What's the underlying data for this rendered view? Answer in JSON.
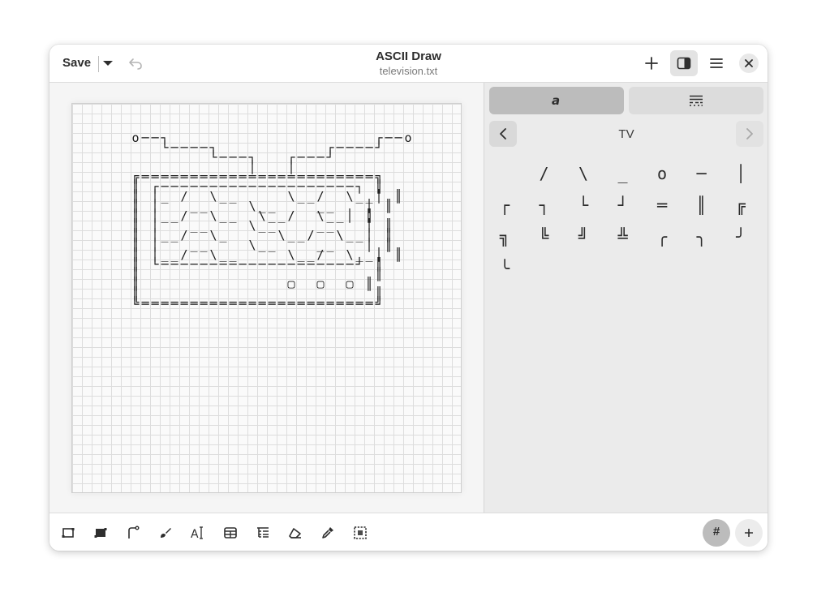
{
  "header": {
    "save_label": "Save",
    "title": "ASCII Draw",
    "subtitle": "television.txt",
    "icons": [
      "chevron-down-icon",
      "undo-icon",
      "plus-icon",
      "sidebar-toggle-icon",
      "hamburger-menu-icon",
      "close-icon"
    ]
  },
  "canvas": {
    "lines": [
      "",
      "",
      "",
      "      o──┐                     ┌──o",
      "         └────┐           ┌────┘",
      "              └───┐   ┌───┘",
      "                  │   │",
      "      ╔════════════════════════╗",
      "      ║ ┌────────────────────┐ ║",
      "      ║ │_ /  \\__     \\__/  \\__│ ║",
      "      ║ │   __    \\__    __   │ ║",
      "      ║ │__/  \\__  \\__/  \\__│ ║",
      "      ║ │   __    \\__    __   │ ║",
      "      ║ │__/  \\_     \\__/  \\__│ ║",
      "      ║ │   __    \\__    __   │ ║",
      "      ║ │__/  \\__     \\__/  \\__│ ║",
      "      ║ └────────────────────┘ ║",
      "      ║                        ║",
      "      ║               ▢  ▢  ▢ ║",
      "      ║                        ║",
      "      ╚════════════════════════╝"
    ]
  },
  "sidebar": {
    "tabs": [
      "characters-icon",
      "lines-icon"
    ],
    "category": "TV",
    "glyph_rows": [
      [
        "",
        "/",
        "\\",
        "_",
        "o",
        "─",
        "│"
      ],
      [
        "┌",
        "┐",
        "└",
        "┘",
        "═",
        "║",
        "╔"
      ],
      [
        "╗",
        "╚",
        "╝",
        "╩",
        "╭",
        "╮",
        "╯"
      ],
      [
        "╰"
      ]
    ]
  },
  "toolbar": {
    "tools": [
      "rectangle-icon",
      "filled-rectangle-icon",
      "line-icon",
      "freehand-brush-icon",
      "text-icon",
      "table-icon",
      "tree-list-icon",
      "eraser-icon",
      "color-picker-icon",
      "select-icon"
    ],
    "grid_label": "#"
  }
}
